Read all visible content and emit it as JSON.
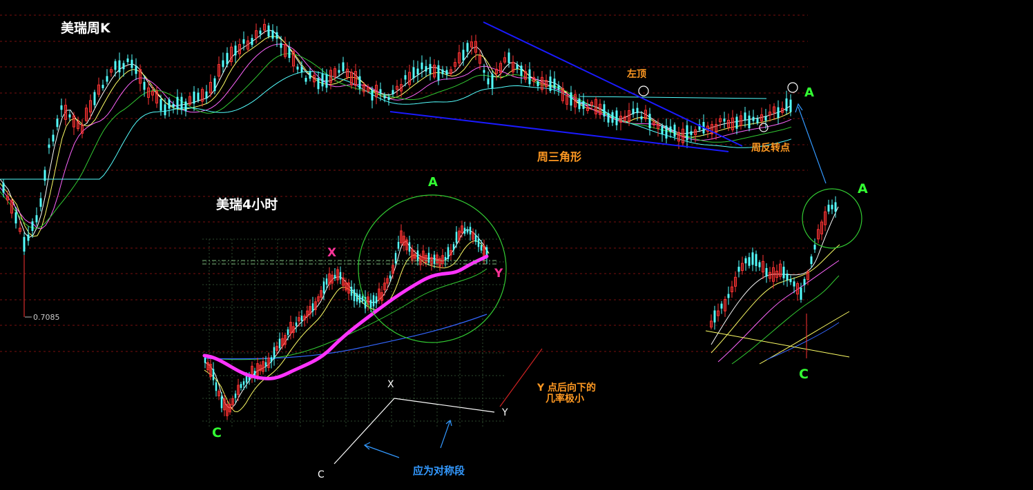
{
  "chart_data": [
    {
      "type": "candlestick",
      "title": "美瑞周K",
      "price_label": "0.7085",
      "annotations": {
        "left_top": "左顶",
        "triangle": "周三角形",
        "reversal": "周反转点",
        "a_mark": "A"
      }
    },
    {
      "type": "candlestick",
      "title": "美瑞4小时",
      "points": {
        "a": "A",
        "x": "X",
        "y": "Y",
        "c": "C"
      }
    },
    {
      "type": "candlestick",
      "points": {
        "a": "A",
        "c": "C"
      }
    }
  ],
  "annotations": {
    "y_note_line1": "Y 点后向下的",
    "y_note_line2": "几率极小",
    "symmetry_note": "应为对称段",
    "sketch": {
      "x": "X",
      "y": "Y",
      "c": "C"
    }
  },
  "colors": {
    "background": "#000000",
    "bull": "#ff3333",
    "bear": "#54ffff",
    "blue_line": "#1a1aff",
    "magenta_ma": "#ff33ff",
    "green_text": "#33ff33",
    "orange_text": "#ff9922",
    "pink_text": "#ff3399"
  }
}
